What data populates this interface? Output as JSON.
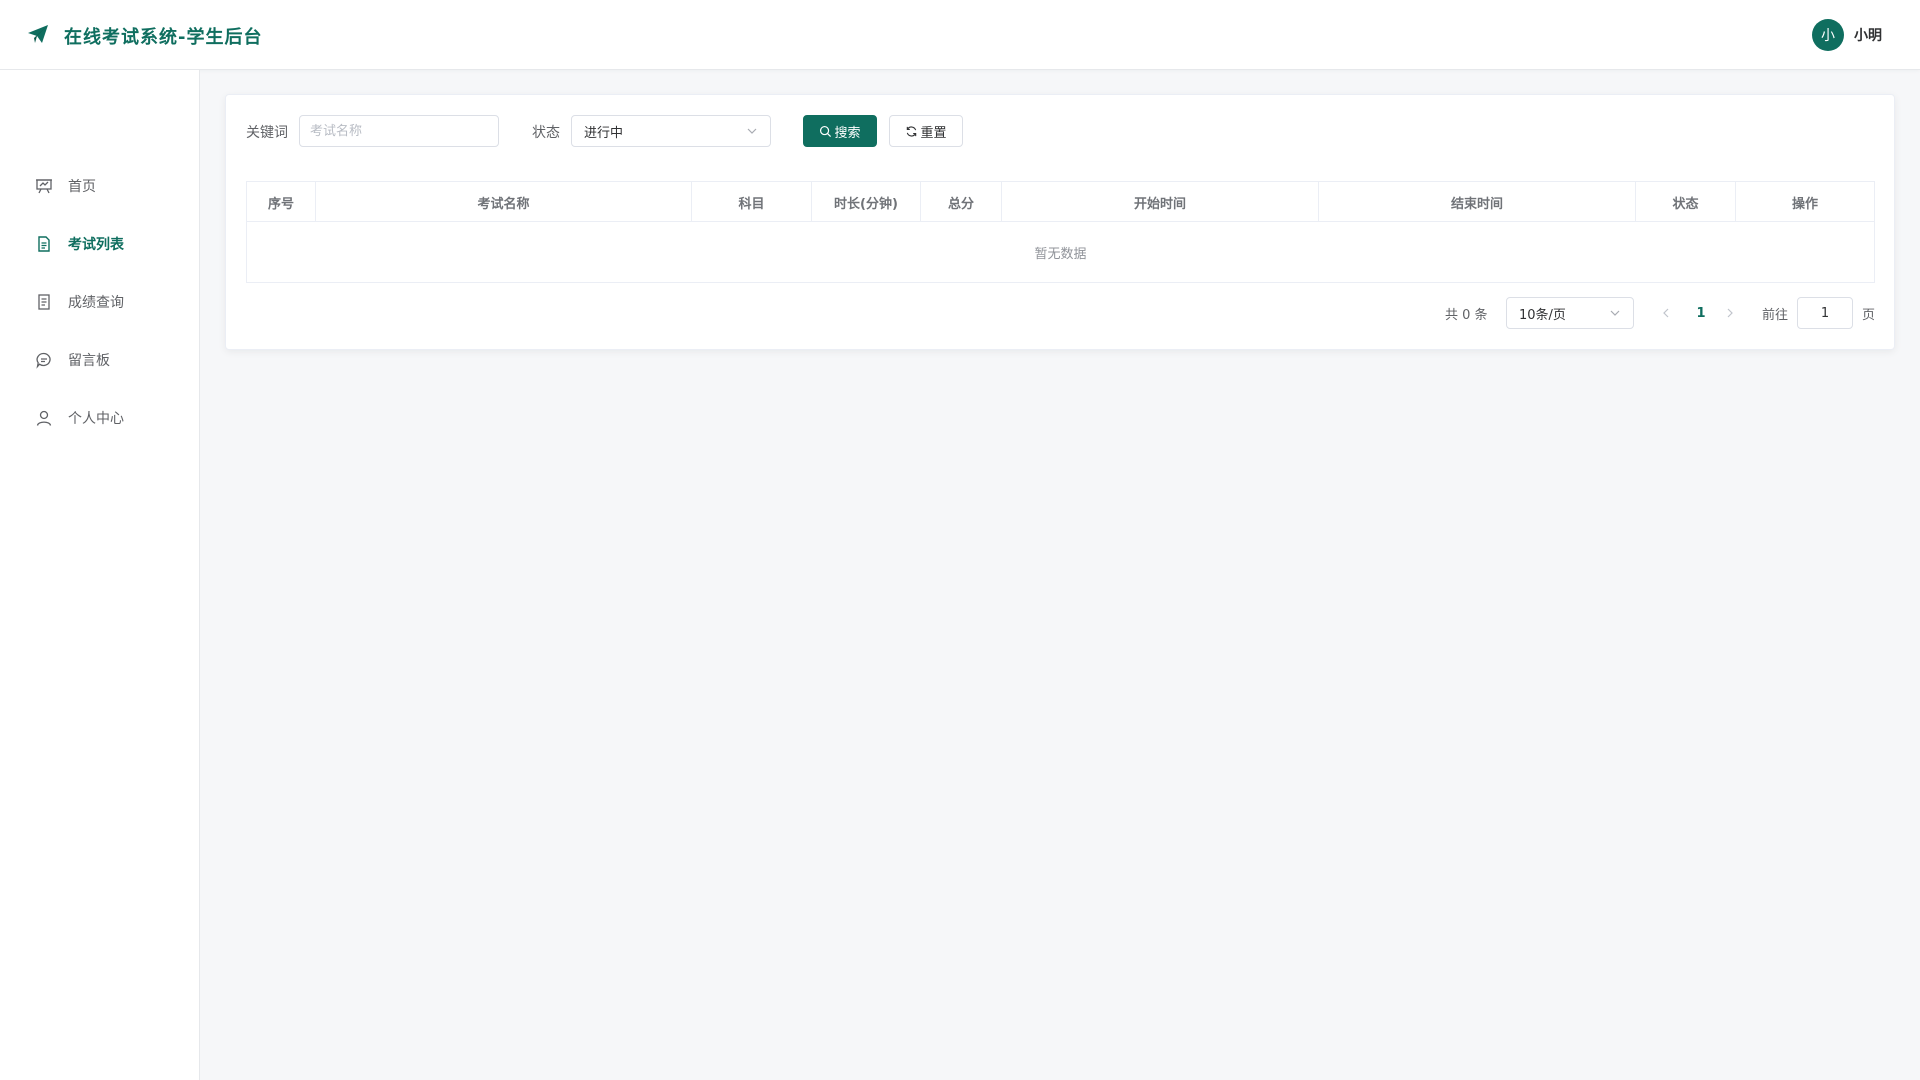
{
  "header": {
    "title": "在线考试系统-学生后台",
    "logo_icon": "paper-plane-icon",
    "avatar_initial": "小",
    "username": "小明",
    "brand_color": "#0f6e5f"
  },
  "sidebar": {
    "items": [
      {
        "label": "首页",
        "icon": "presentation-board-icon",
        "active": false
      },
      {
        "label": "考试列表",
        "icon": "document-icon",
        "active": true
      },
      {
        "label": "成绩查询",
        "icon": "score-sheet-icon",
        "active": false
      },
      {
        "label": "留言板",
        "icon": "chat-bubble-icon",
        "active": false
      },
      {
        "label": "个人中心",
        "icon": "user-icon",
        "active": false
      }
    ]
  },
  "filters": {
    "keyword_label": "关键词",
    "keyword_placeholder": "考试名称",
    "keyword_value": "",
    "status_label": "状态",
    "status_value": "进行中",
    "search_label": "搜索",
    "reset_label": "重置"
  },
  "table": {
    "columns": [
      "序号",
      "考试名称",
      "科目",
      "时长(分钟)",
      "总分",
      "开始时间",
      "结束时间",
      "状态",
      "操作"
    ],
    "rows": [],
    "empty_text": "暂无数据"
  },
  "pagination": {
    "total_text": "共 0 条",
    "page_size": "10条/页",
    "current_page": "1",
    "goto_label": "前往",
    "goto_value": "1",
    "page_suffix": "页"
  }
}
